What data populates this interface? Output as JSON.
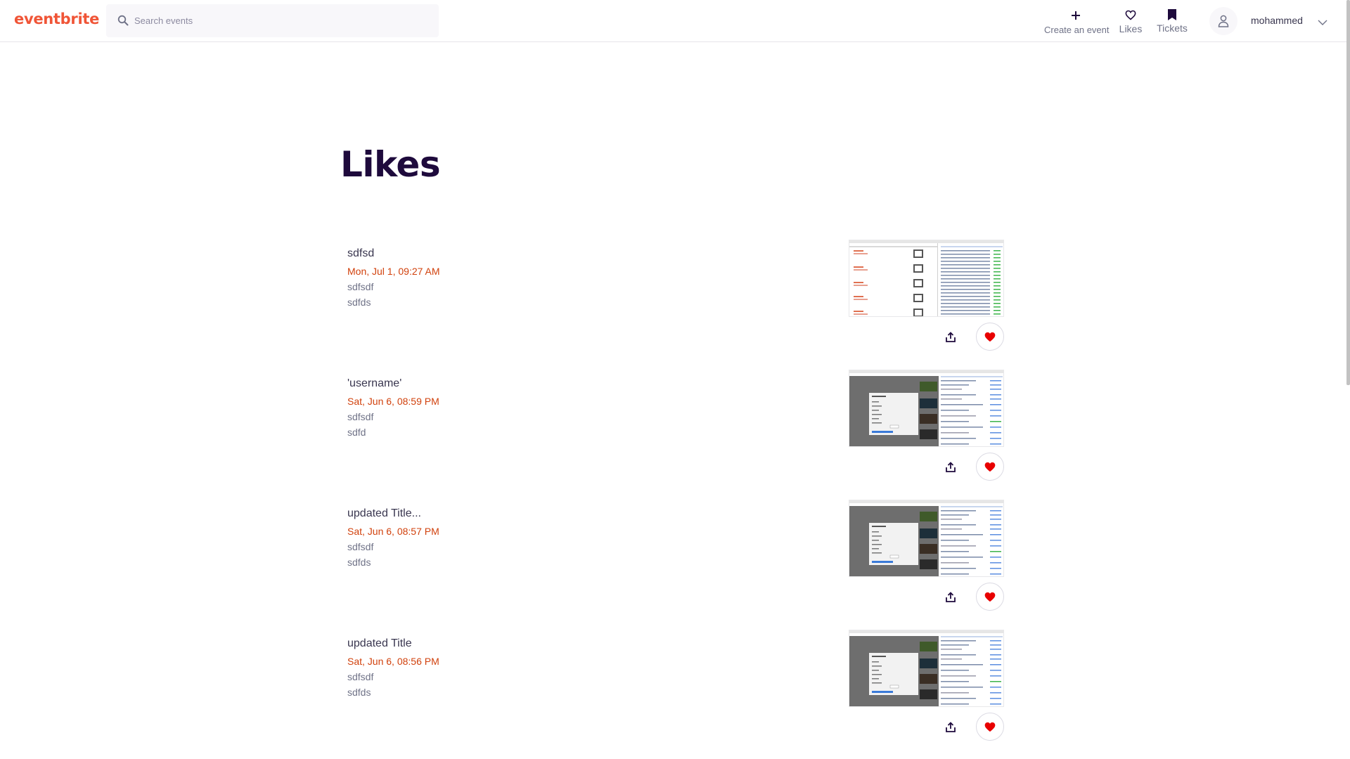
{
  "header": {
    "logo": "eventbrite",
    "search": {
      "placeholder": "Search events",
      "value": ""
    },
    "nav": {
      "create": "Create an event",
      "likes": "Likes",
      "tickets": "Tickets"
    },
    "user": {
      "name": "mohammed"
    }
  },
  "main": {
    "title": "Likes",
    "events": [
      {
        "title": "sdfsd",
        "date": "Mon, Jul 1, 09:27 AM",
        "line1": "sdfsdf",
        "line2": "sdfds"
      },
      {
        "title": "'username'",
        "date": "Sat, Jun 6, 08:59 PM",
        "line1": "sdfsdf",
        "line2": "sdfd"
      },
      {
        "title": "updated Title...",
        "date": "Sat, Jun 6, 08:57 PM",
        "line1": "sdfsdf",
        "line2": "sdfds"
      },
      {
        "title": "updated Title",
        "date": "Sat, Jun 6, 08:56 PM",
        "line1": "sdfsdf",
        "line2": "sdfds"
      }
    ]
  },
  "colors": {
    "brand": "#f05537",
    "date": "#d1410c",
    "heading": "#1e0a3c",
    "like": "#e80000"
  }
}
